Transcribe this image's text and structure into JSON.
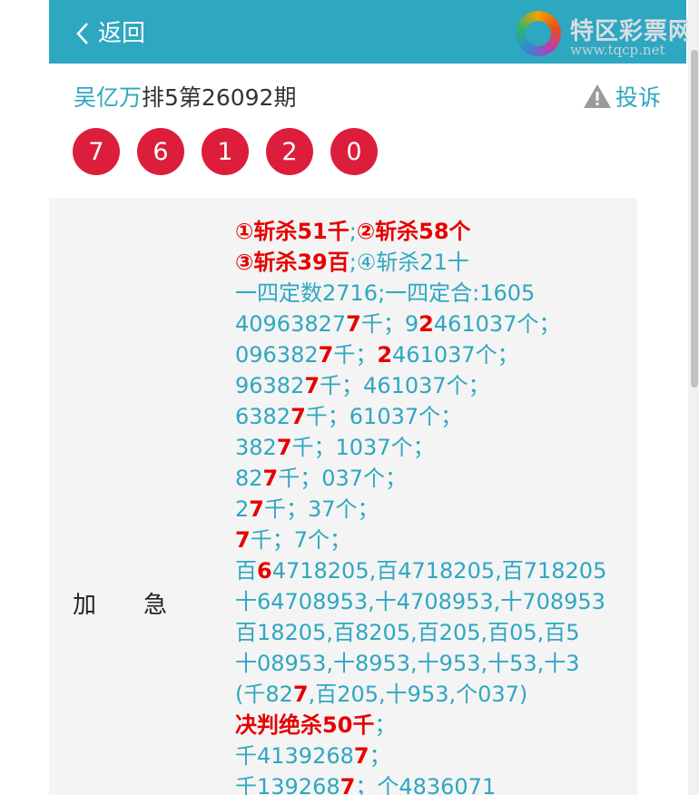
{
  "header": {
    "back_label": "返回",
    "logo_name": "特区彩票网",
    "logo_url": "www.tqcp.net"
  },
  "title": {
    "author": "吴亿万",
    "text": "排5第26092期"
  },
  "report_label": "投诉",
  "balls": [
    "7",
    "6",
    "1",
    "2",
    "0"
  ],
  "row_label": [
    "加",
    "急"
  ],
  "lines": [
    [
      {
        "t": "①斩杀51千",
        "r": 1
      },
      {
        "t": ";"
      },
      {
        "t": "②斩杀58个",
        "r": 1
      }
    ],
    [
      {
        "t": "③斩杀39百",
        "r": 1
      },
      {
        "t": ";④斩杀21十"
      }
    ],
    [
      {
        "t": "一四定数2716;一四定合:1605"
      }
    ],
    [
      {
        "t": "40963827"
      },
      {
        "t": "7",
        "r": 1
      },
      {
        "t": "千；9"
      },
      {
        "t": "2",
        "r": 1
      },
      {
        "t": "461037个；"
      }
    ],
    [
      {
        "t": "096382"
      },
      {
        "t": "7",
        "r": 1
      },
      {
        "t": "千；"
      },
      {
        "t": "2",
        "r": 1
      },
      {
        "t": "461037个；"
      }
    ],
    [
      {
        "t": "96382"
      },
      {
        "t": "7",
        "r": 1
      },
      {
        "t": "千；461037个；"
      }
    ],
    [
      {
        "t": "6382"
      },
      {
        "t": "7",
        "r": 1
      },
      {
        "t": "千；61037个；"
      }
    ],
    [
      {
        "t": "382"
      },
      {
        "t": "7",
        "r": 1
      },
      {
        "t": "千；1037个；"
      }
    ],
    [
      {
        "t": "82"
      },
      {
        "t": "7",
        "r": 1
      },
      {
        "t": "千；037个；"
      }
    ],
    [
      {
        "t": "2"
      },
      {
        "t": "7",
        "r": 1
      },
      {
        "t": "千；37个；"
      }
    ],
    [
      {
        "t": "7",
        "r": 1
      },
      {
        "t": "千；7个；"
      }
    ],
    [
      {
        "t": "百"
      },
      {
        "t": "6",
        "r": 1
      },
      {
        "t": "4718205,百4718205,百718205"
      }
    ],
    [
      {
        "t": "十64708953,十4708953,十708953"
      }
    ],
    [
      {
        "t": "百18205,百8205,百205,百05,百5"
      }
    ],
    [
      {
        "t": "十08953,十8953,十953,十53,十3"
      }
    ],
    [
      {
        "t": "(千82"
      },
      {
        "t": "7",
        "r": 1
      },
      {
        "t": ",百205,十953,个037)"
      }
    ],
    [
      {
        "t": "决判绝杀50千",
        "r": 1
      },
      {
        "t": "；"
      }
    ],
    [
      {
        "t": "千4139268"
      },
      {
        "t": "7",
        "r": 1
      },
      {
        "t": "；"
      }
    ],
    [
      {
        "t": "千139268"
      },
      {
        "t": "7",
        "r": 1
      },
      {
        "t": "；个4836071"
      }
    ]
  ]
}
